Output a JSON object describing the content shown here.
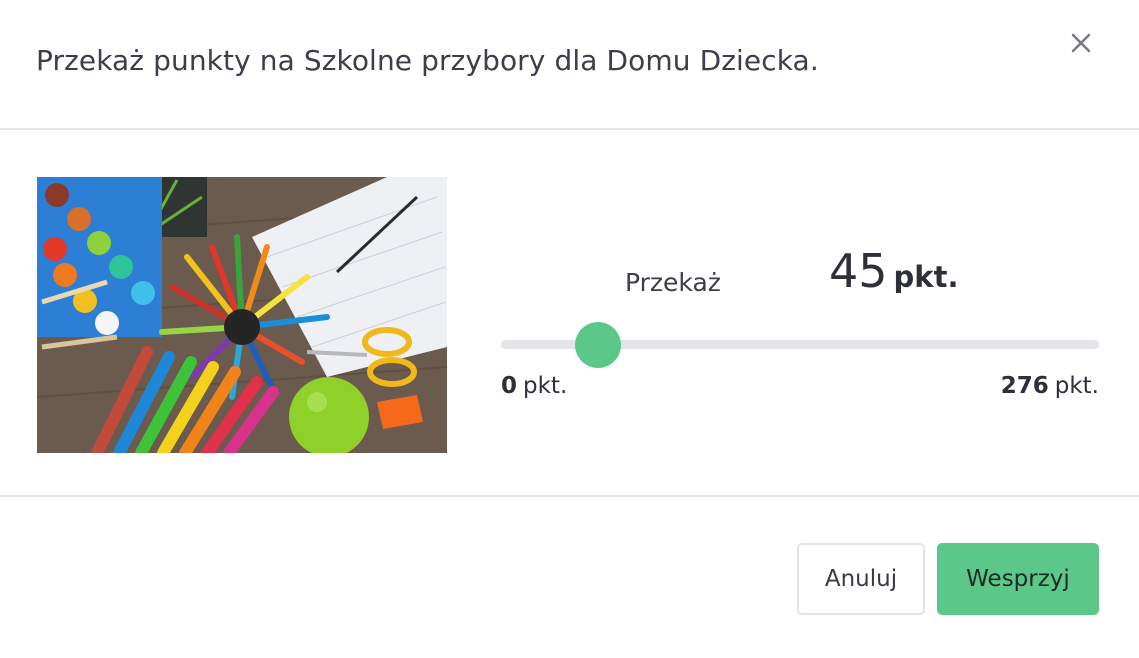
{
  "modal": {
    "title": "Przekaż punkty na Szkolne przybory dla Domu Dziecka.",
    "close_icon": "close-icon"
  },
  "image": {
    "alt": "school-supplies-photo"
  },
  "transfer": {
    "label": "Przekaż",
    "value": "45",
    "unit": "pkt.",
    "slider_fraction": 0.163,
    "min_value": "0",
    "min_unit": "pkt.",
    "max_value": "276",
    "max_unit": "pkt."
  },
  "footer": {
    "cancel_label": "Anuluj",
    "support_label": "Wesprzyj"
  },
  "colors": {
    "accent": "#5bc88a",
    "track": "#e2e4e8",
    "divider": "#e6e7ea",
    "text": "#3d3d4b"
  }
}
